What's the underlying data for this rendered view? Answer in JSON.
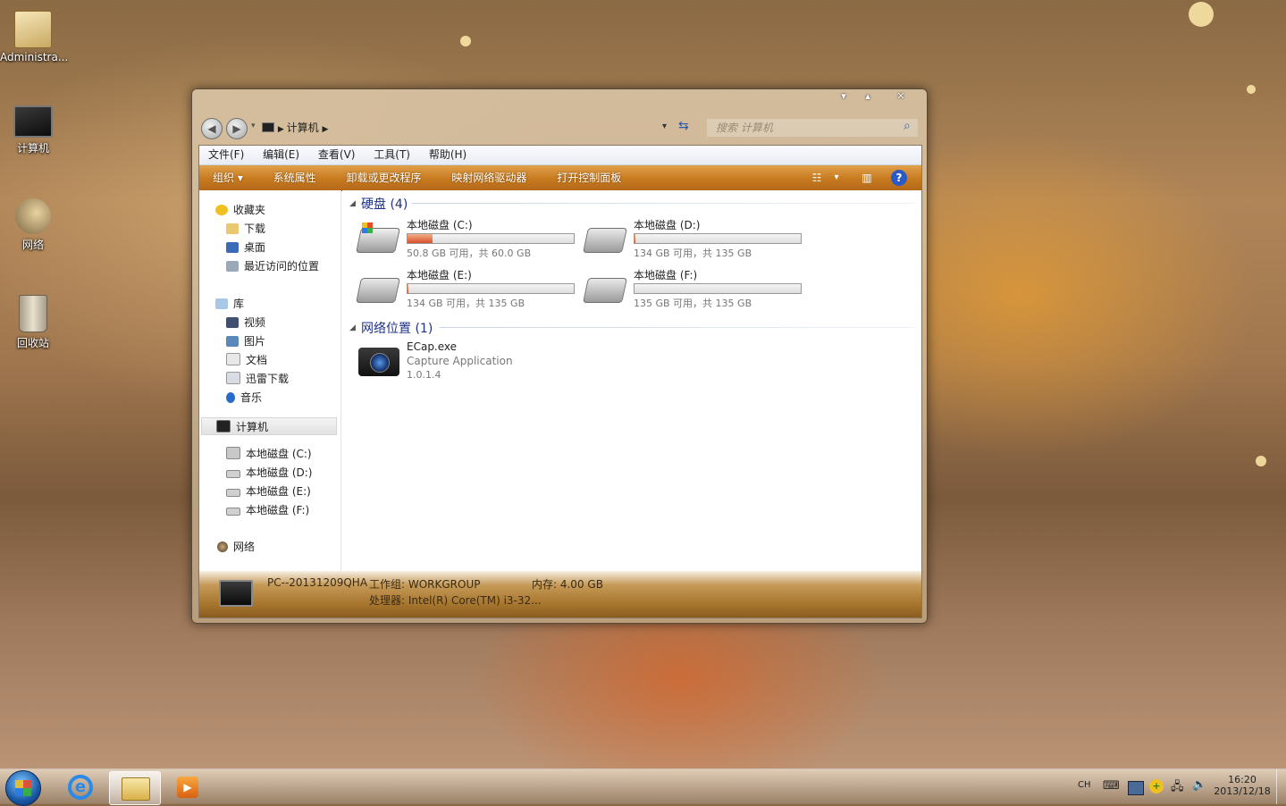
{
  "desktop": {
    "icons": [
      {
        "label": "Administra..."
      },
      {
        "label": "计算机"
      },
      {
        "label": "网络"
      },
      {
        "label": "回收站"
      }
    ]
  },
  "window": {
    "controls": {
      "minimize": "▾",
      "maximize": "▴",
      "close": "✕"
    },
    "address": {
      "root_icon": "computer-icon",
      "path": "计算机"
    },
    "search": {
      "placeholder": "搜索 计算机"
    },
    "menu": [
      "文件(F)",
      "编辑(E)",
      "查看(V)",
      "工具(T)",
      "帮助(H)"
    ],
    "toolbar": {
      "organize": "组织 ▾",
      "items": [
        "系统属性",
        "卸载或更改程序",
        "映射网络驱动器",
        "打开控制面板"
      ]
    },
    "nav": {
      "favorites_header": "收藏夹",
      "favorites": [
        "下载",
        "桌面",
        "最近访问的位置"
      ],
      "library_header": "库",
      "library": [
        "视频",
        "图片",
        "文档",
        "迅雷下载",
        "音乐"
      ],
      "computer_header": "计算机",
      "drives": [
        "本地磁盘 (C:)",
        "本地磁盘 (D:)",
        "本地磁盘 (E:)",
        "本地磁盘 (F:)"
      ],
      "network": "网络"
    },
    "hard_disks": {
      "header": "硬盘 (4)",
      "drives": [
        {
          "name": "本地磁盘 (C:)",
          "info": "50.8 GB 可用，共 60.0 GB",
          "used_fraction": 0.153
        },
        {
          "name": "本地磁盘 (D:)",
          "info": "134 GB 可用，共 135 GB",
          "used_fraction": 0.007
        },
        {
          "name": "本地磁盘 (E:)",
          "info": "134 GB 可用，共 135 GB",
          "used_fraction": 0.007
        },
        {
          "name": "本地磁盘 (F:)",
          "info": "135 GB 可用，共 135 GB",
          "used_fraction": 0.0
        }
      ]
    },
    "network_locations": {
      "header": "网络位置 (1)",
      "item": {
        "name": "ECap.exe",
        "desc": "Capture Application",
        "version": "1.0.1.4"
      }
    },
    "status": {
      "pc_name": "PC--20131209QHA",
      "workgroup": "工作组: WORKGROUP",
      "memory": "内存: 4.00 GB",
      "processor": "处理器: Intel(R) Core(TM) i3-32..."
    }
  },
  "taskbar": {
    "tray": {
      "lang": "CH",
      "time": "16:20",
      "date": "2013/12/18"
    }
  },
  "colors": {
    "toolbar_orange": "#c77a1f",
    "group_header_blue": "#1e3287",
    "drive_fill": "#d8502a"
  }
}
